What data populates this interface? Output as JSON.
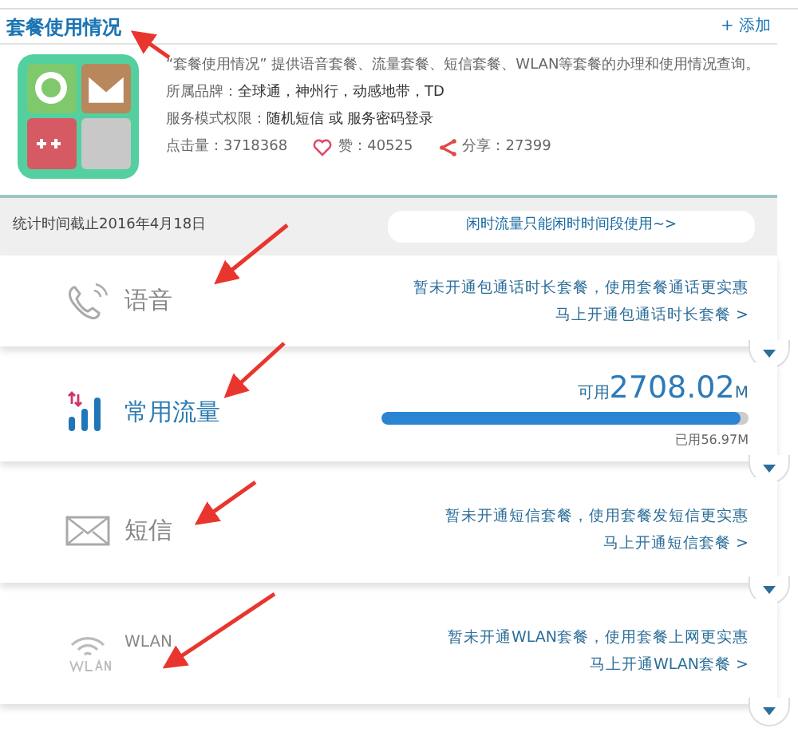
{
  "header": {
    "title": "套餐使用情况",
    "add_link": "+ 添加"
  },
  "app": {
    "description": "“套餐使用情况” 提供语音套餐、流量套餐、短信套餐、WLAN等套餐的办理和使用情况查询。",
    "brand_label": "所属品牌：",
    "brand_value": "全球通，神州行，动感地带，TD",
    "auth_label": "服务模式权限：",
    "auth_value": "随机短信 或 服务密码登录",
    "clicks": "点击量：3718368",
    "likes": "赞：40525",
    "shares": "分享：27399"
  },
  "stats": {
    "date": "统计时间截止2016年4月18日",
    "notice_button": "闲时流量只能闲时时间段使用~>"
  },
  "cards": [
    {
      "kind": "notice",
      "label": "语音",
      "line_1": "暂未开通包通话时长套餐，使用套餐通话更实惠",
      "line_2": "马上开通包通话时长套餐 >"
    },
    {
      "kind": "usage",
      "label": "常用流量",
      "available_label": "可用",
      "available_value": "2708.02",
      "available_unit": "M",
      "level": 0.98,
      "used": "已用56.97M"
    },
    {
      "kind": "notice",
      "label": "短信",
      "line_1": "暂未开通短信套餐，使用套餐发短信更实惠",
      "line_2": "马上开通短信套餐 >"
    },
    {
      "kind": "notice",
      "label": "WLAN",
      "line_1": "暂未开通WLAN套餐，使用套餐上网更实惠",
      "line_2": "马上开通WLAN套餐 >"
    }
  ]
}
